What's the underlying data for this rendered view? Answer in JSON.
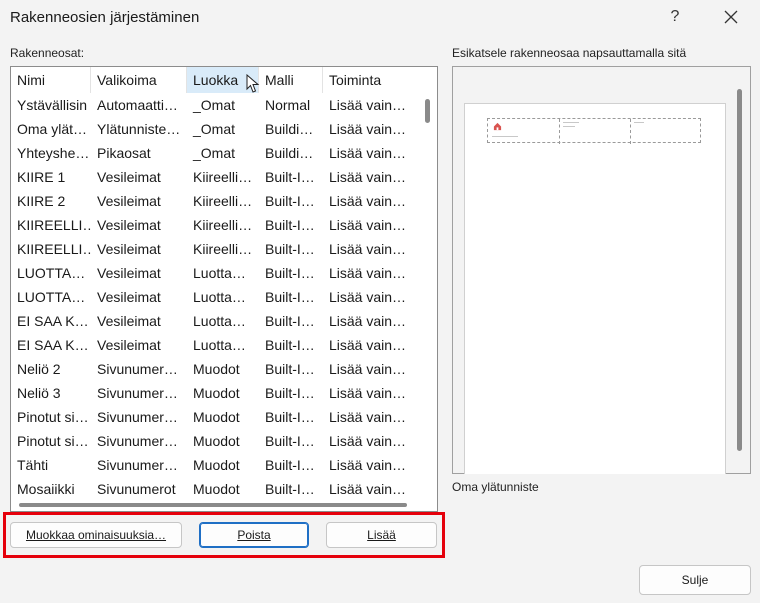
{
  "window": {
    "title": "Rakenneosien järjestäminen",
    "help_label": "?"
  },
  "list": {
    "label": "Rakenneosat:",
    "columns": [
      "Nimi",
      "Valikoima",
      "Luokka",
      "Malli",
      "Toiminta"
    ],
    "sorted_column": "Luokka",
    "rows": [
      [
        "Ystävällisin",
        "Automaatti…",
        "_Omat",
        "Normal",
        "Lisää vain…"
      ],
      [
        "Oma ylät…",
        "Ylätunniste…",
        "_Omat",
        "Buildi…",
        "Lisää vain…"
      ],
      [
        "Yhteyshe…",
        "Pikaosat",
        "_Omat",
        "Buildi…",
        "Lisää vain…"
      ],
      [
        "KIIRE 1",
        "Vesileimat",
        "Kiireelli…",
        "Built-I…",
        "Lisää vain…"
      ],
      [
        "KIIRE 2",
        "Vesileimat",
        "Kiireelli…",
        "Built-I…",
        "Lisää vain…"
      ],
      [
        "KIIREELLI…",
        "Vesileimat",
        "Kiireelli…",
        "Built-I…",
        "Lisää vain…"
      ],
      [
        "KIIREELLI…",
        "Vesileimat",
        "Kiireelli…",
        "Built-I…",
        "Lisää vain…"
      ],
      [
        "LUOTTA…",
        "Vesileimat",
        "Luotta…",
        "Built-I…",
        "Lisää vain…"
      ],
      [
        "LUOTTA…",
        "Vesileimat",
        "Luotta…",
        "Built-I…",
        "Lisää vain…"
      ],
      [
        "EI SAA K…",
        "Vesileimat",
        "Luotta…",
        "Built-I…",
        "Lisää vain…"
      ],
      [
        "EI SAA K…",
        "Vesileimat",
        "Luotta…",
        "Built-I…",
        "Lisää vain…"
      ],
      [
        "Neliö 2",
        "Sivunumer…",
        "Muodot",
        "Built-I…",
        "Lisää vain…"
      ],
      [
        "Neliö 3",
        "Sivunumer…",
        "Muodot",
        "Built-I…",
        "Lisää vain…"
      ],
      [
        "Pinotut si…",
        "Sivunumer…",
        "Muodot",
        "Built-I…",
        "Lisää vain…"
      ],
      [
        "Pinotut si…",
        "Sivunumer…",
        "Muodot",
        "Built-I…",
        "Lisää vain…"
      ],
      [
        "Tähti",
        "Sivunumer…",
        "Muodot",
        "Built-I…",
        "Lisää vain…"
      ],
      [
        "Mosaiikki",
        "Sivunumerot",
        "Muodot",
        "Built-I…",
        "Lisää vain…"
      ]
    ]
  },
  "preview": {
    "label": "Esikatsele rakenneosaa napsauttamalla sitä",
    "caption": "Oma ylätunniste"
  },
  "buttons": {
    "edit": "Muokkaa ominaisuuksia…",
    "delete": "Poista",
    "insert": "Lisää",
    "close": "Sulje"
  },
  "colors": {
    "highlight_frame": "#e5000b",
    "sorted_header_bg": "#d9ebf9",
    "default_button_border": "#1f6fc5"
  },
  "icons": {
    "close": "close-icon",
    "cursor": "mouse-pointer-icon",
    "preview_logo": "home-icon"
  }
}
